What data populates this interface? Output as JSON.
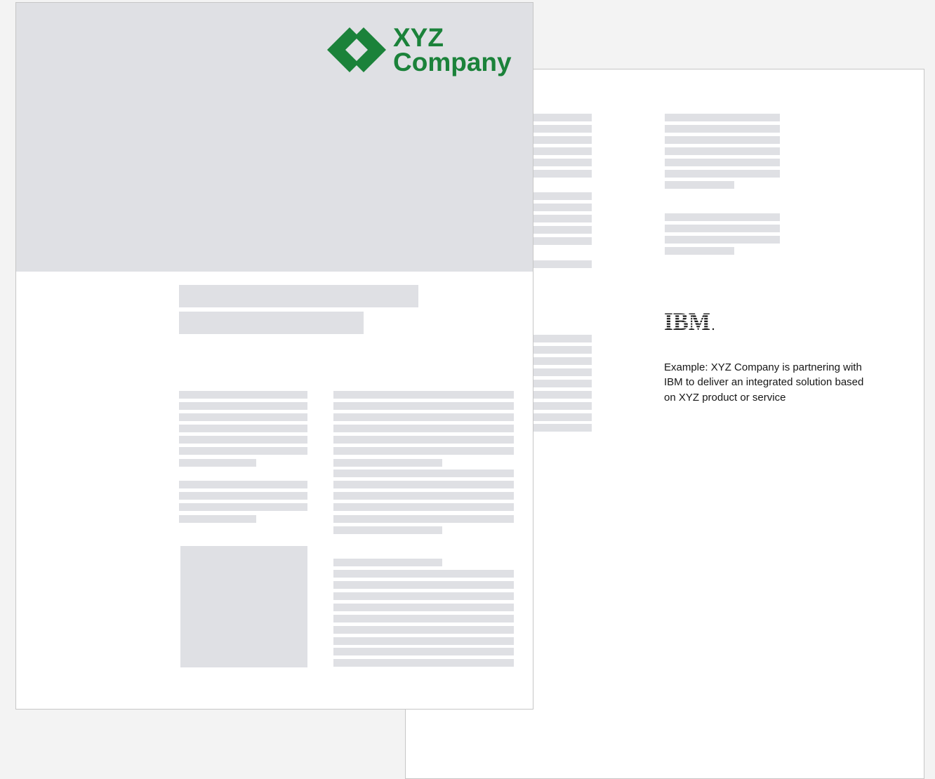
{
  "front_page": {
    "logo": {
      "icon": "diamond-logo-icon",
      "line1": "XYZ",
      "line2": "Company",
      "color": "#1b823a"
    }
  },
  "back_page": {
    "partner_logo": "IBM",
    "caption": "Example: XYZ Company is partnering with IBM to deliver an integrated solution based on XYZ product or service"
  },
  "colors": {
    "placeholder": "#dfe0e4",
    "background": "#f3f3f3",
    "page": "#ffffff",
    "brand_green": "#1b823a",
    "text": "#161616"
  }
}
